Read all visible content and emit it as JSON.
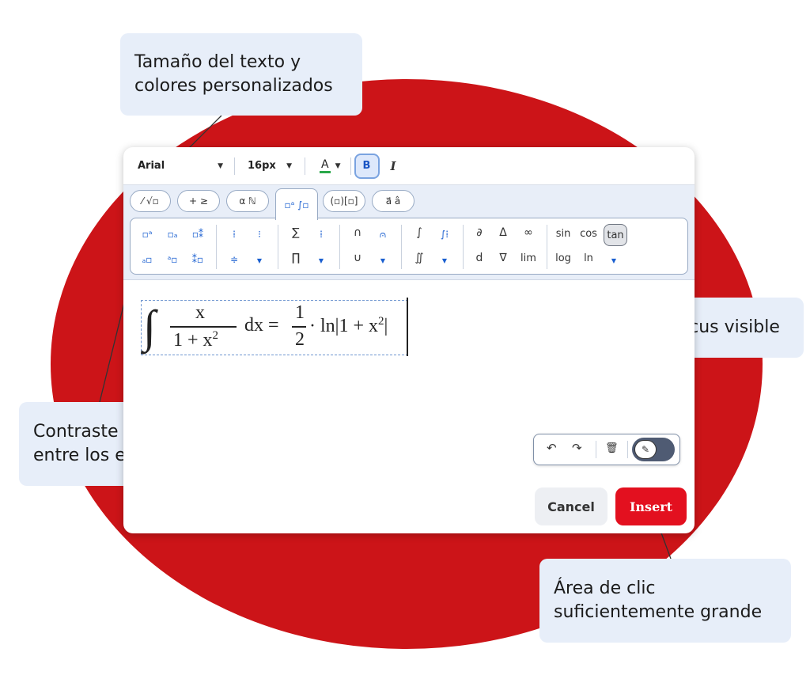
{
  "callouts": {
    "top": {
      "line1": "Tamaño del texto y",
      "line2": "colores personalizados"
    },
    "left": {
      "line1": "Contraste de color",
      "line2": "entre los elementos"
    },
    "right": {
      "line1": "Estado focus visible"
    },
    "bottom": {
      "line1": "Área de clic",
      "line2": "suficientemente grande"
    }
  },
  "toolbar": {
    "font_family": "Arial",
    "font_size": "16px",
    "color_label": "A",
    "bold_label": "B",
    "italic_label": "I",
    "color_underline": "#2aa84a"
  },
  "tabs": [
    {
      "label": "⁄ √▫"
    },
    {
      "label": "+ ≥"
    },
    {
      "label": "α ℕ"
    },
    {
      "label": "▫ᵃ ∫▫"
    },
    {
      "label": "(▫)[▫]"
    },
    {
      "label": "a⃗ â"
    }
  ],
  "palette": {
    "sum": "∑",
    "prod": "∏",
    "cap": "∩",
    "cup": "∪",
    "integral": "∫",
    "double_integral": "∬",
    "partial": "∂",
    "delta": "Δ",
    "infinity": "∞",
    "d": "d",
    "nabla": "∇",
    "lim": "lim",
    "sin": "sin",
    "cos": "cos",
    "tan": "tan",
    "log": "log",
    "ln": "ln"
  },
  "formula": {
    "integral": "∫",
    "num": "x",
    "den": "1 + x",
    "den_sup": "2",
    "dx": "dx =",
    "half_num": "1",
    "half_den": "2",
    "rest": "· ln|1 + x",
    "rest_sup": "2",
    "close": "|"
  },
  "history": {
    "undo": "↶",
    "redo": "↷",
    "trash": "🗑",
    "toggle": "✎"
  },
  "actions": {
    "cancel": "Cancel",
    "insert": "Insert"
  },
  "colors": {
    "brand_red": "#cc1418",
    "insert_red": "#e3101f",
    "accent_blue": "#1a5fd0"
  }
}
